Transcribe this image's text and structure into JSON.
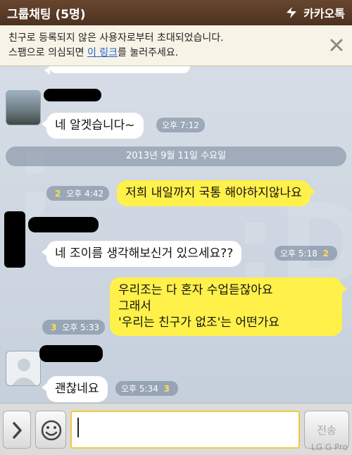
{
  "header": {
    "title": "그룹채팅 (5명)",
    "brand": "카카오톡"
  },
  "notice": {
    "line1": "친구로 등록되지 않은 사용자로부터 초대되었습니다.",
    "line2_pre": "스팸으로 의심되면 ",
    "line2_link": "이 링크",
    "line2_post": "를 눌러주세요."
  },
  "date_divider": "2013년 9월 11일 수요일",
  "messages": [
    {
      "text": "네 알겟습니다~",
      "time": "오후 7:12",
      "unread": ""
    },
    {
      "text": "저희 내일까지 국통 해야하지않나요",
      "time": "오후 4:42",
      "unread": "2"
    },
    {
      "text": "네 조이름 생각해보신거 있으세요??",
      "time": "오후 5:18",
      "unread": "2"
    },
    {
      "text_lines": [
        "우리조는 다 혼자 수업듣잖아요",
        "그래서",
        "'우리는 친구가 없조'는 어떤가요"
      ],
      "time": "오후 5:33",
      "unread": "3"
    },
    {
      "text": "괜찮네요",
      "time": "오후 5:34",
      "unread": "3"
    }
  ],
  "input": {
    "value": "",
    "send_label": "전송"
  },
  "device_watermark": "LG G Pro",
  "colors": {
    "header": "#5a3c27",
    "my_bubble": "#fff14a",
    "their_bubble": "#ffffff",
    "chat_bg": "#cfd8e3"
  }
}
